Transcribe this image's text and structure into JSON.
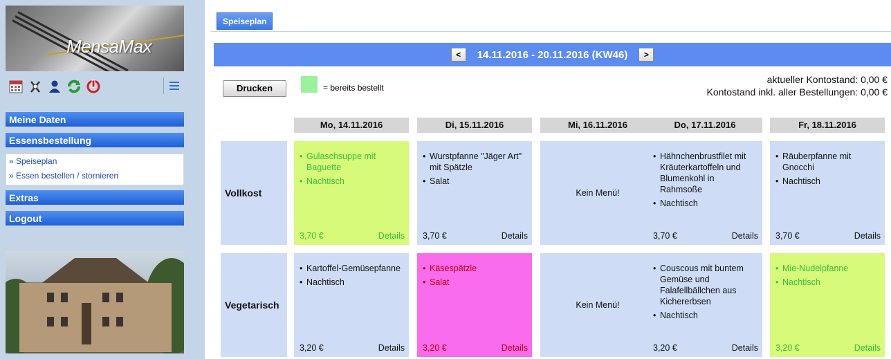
{
  "sidebar": {
    "logo_text": "MensaMax",
    "nav": {
      "meine_daten": "Meine Daten",
      "essensbestellung": "Essensbestellung",
      "speiseplan": "» Speiseplan",
      "bestellen": "» Essen bestellen / stornieren",
      "extras": "Extras",
      "logout": "Logout"
    }
  },
  "main": {
    "tab": "Speiseplan",
    "week": {
      "prev": "<",
      "label": "14.11.2016 - 20.11.2016 (KW46)",
      "next": ">"
    },
    "print_label": "Drucken",
    "legend_text": "= bereits bestellt",
    "balance_current": "aktueller Kontostand: 0,00 €",
    "balance_total": "Kontostand inkl. aller Bestellungen: 0,00 €",
    "days": [
      "Mo, 14.11.2016",
      "Di, 15.11.2016",
      "Mi, 16.11.2016",
      "Do, 17.11.2016",
      "Fr, 18.11.2016"
    ],
    "rows": [
      "Vollkost",
      "Vegetarisch"
    ],
    "details_label": "Details",
    "no_menu": "Kein Menü!",
    "meals": {
      "r0c0": {
        "items": [
          "Gulaschsuppe mit Baguette",
          "Nachtisch"
        ],
        "price": "3,70 €",
        "state": "ordered"
      },
      "r0c1": {
        "items": [
          "Wurstpfanne \"Jäger Art\" mit Spätzle",
          "Salat"
        ],
        "price": "3,70 €",
        "state": "normal"
      },
      "r0c3": {
        "items": [
          "Hähnchenbrustfilet mit Kräuterkartoffeln und Blumenkohl in Rahmsoße",
          "Nachtisch"
        ],
        "price": "3,70 €",
        "state": "normal"
      },
      "r0c4": {
        "items": [
          "Räuberpfanne mit Gnocchi",
          "Nachtisch"
        ],
        "price": "3,70 €",
        "state": "normal"
      },
      "r1c0": {
        "items": [
          "Kartoffel-Gemüsepfanne",
          "Nachtisch"
        ],
        "price": "3,20 €",
        "state": "normal"
      },
      "r1c1": {
        "items": [
          "Käsespätzle",
          "Salat"
        ],
        "price": "3,20 €",
        "state": "pink"
      },
      "r1c3": {
        "items": [
          "Couscous mit buntem Gemüse und Falafellbällchen aus Kichererbsen",
          "Nachtisch"
        ],
        "price": "3,20 €",
        "state": "normal"
      },
      "r1c4": {
        "items": [
          "Mie-Nudelpfanne",
          "Nachtisch"
        ],
        "price": "3,20 €",
        "state": "ordered"
      }
    }
  }
}
